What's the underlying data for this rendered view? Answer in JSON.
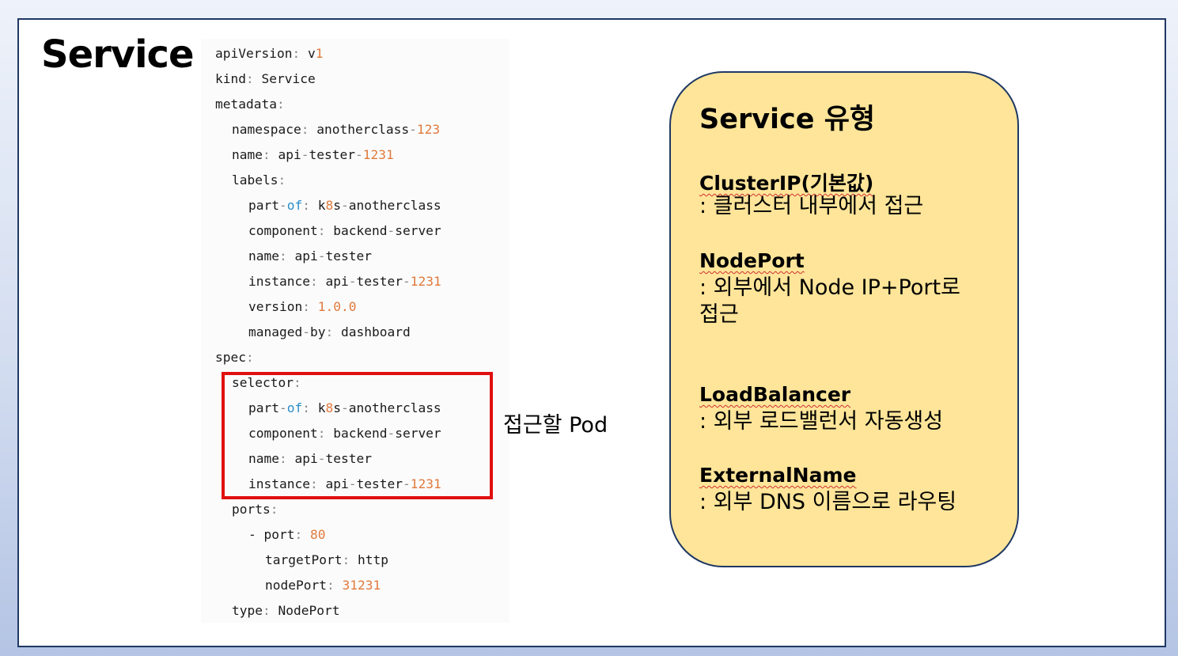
{
  "slide": {
    "title": "Service"
  },
  "code": {
    "lines": [
      {
        "indent": 0,
        "key": "apiVersion",
        "value": "v1"
      },
      {
        "indent": 0,
        "key": "kind",
        "value": "Service"
      },
      {
        "indent": 0,
        "key": "metadata",
        "value": ""
      },
      {
        "indent": 1,
        "key": "namespace",
        "value": "anotherclass-123"
      },
      {
        "indent": 1,
        "key": "name",
        "value": "api-tester-1231"
      },
      {
        "indent": 1,
        "key": "labels",
        "value": ""
      },
      {
        "indent": 2,
        "key": "part-of",
        "value": "k8s-anotherclass"
      },
      {
        "indent": 2,
        "key": "component",
        "value": "backend-server"
      },
      {
        "indent": 2,
        "key": "name",
        "value": "api-tester"
      },
      {
        "indent": 2,
        "key": "instance",
        "value": "api-tester-1231"
      },
      {
        "indent": 2,
        "key": "version",
        "value": "1.0.0"
      },
      {
        "indent": 2,
        "key": "managed-by",
        "value": "dashboard"
      },
      {
        "indent": 0,
        "key": "spec",
        "value": ""
      },
      {
        "indent": 1,
        "key": "selector",
        "value": ""
      },
      {
        "indent": 2,
        "key": "part-of",
        "value": "k8s-anotherclass"
      },
      {
        "indent": 2,
        "key": "component",
        "value": "backend-server"
      },
      {
        "indent": 2,
        "key": "name",
        "value": "api-tester"
      },
      {
        "indent": 2,
        "key": "instance",
        "value": "api-tester-1231"
      },
      {
        "indent": 1,
        "key": "ports",
        "value": ""
      },
      {
        "indent": 2,
        "key": "- port",
        "value": "80"
      },
      {
        "indent": 3,
        "key": "targetPort",
        "value": "http"
      },
      {
        "indent": 3,
        "key": "nodePort",
        "value": "31231"
      },
      {
        "indent": 1,
        "key": "type",
        "value": "NodePort"
      }
    ]
  },
  "annotation": {
    "pod_label": "접근할 Pod"
  },
  "service_types": {
    "title": "Service 유형",
    "items": [
      {
        "name": "ClusterIP(기본값)",
        "desc": ": 클러스터 내부에서 접근"
      },
      {
        "name": "NodePort",
        "desc": ": 외부에서 Node IP+Port로 접근"
      },
      {
        "name": "LoadBalancer",
        "desc": ": 외부 로드밸런서 자동생성"
      },
      {
        "name": "ExternalName",
        "desc": ": 외부 DNS 이름으로 라우팅"
      }
    ]
  },
  "colors": {
    "card_background": "#fee599",
    "highlight_border": "#e01010",
    "frame_border": "#1f3864",
    "number_value": "#e07a3c",
    "keyword": "#2a8fc9"
  }
}
